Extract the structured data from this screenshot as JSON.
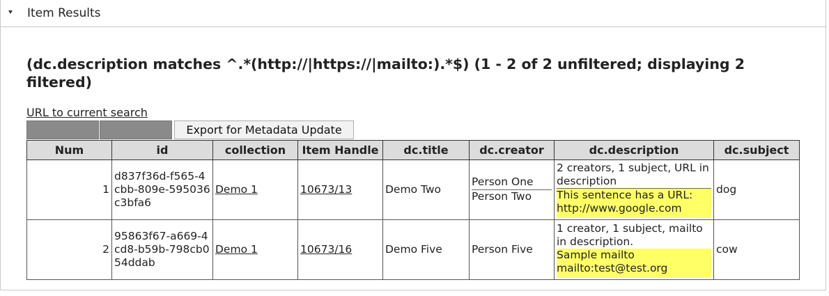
{
  "panel": {
    "title": "Item Results"
  },
  "query": {
    "title": "(dc.description matches ^.*(http://|https://|mailto:).*$) (1 - 2 of 2 unfiltered; displaying 2 filtered)",
    "url_link": "URL to current search"
  },
  "toolbar": {
    "export_label": "Export for Metadata Update"
  },
  "table": {
    "headers": [
      "Num",
      "id",
      "collection",
      "Item Handle",
      "dc.title",
      "dc.creator",
      "dc.description",
      "dc.subject"
    ],
    "rows": [
      {
        "num": "1",
        "id": "d837f36d-f565-4cbb-809e-595036c3bfa6",
        "collection": "Demo 1",
        "handle": "10673/13",
        "title": "Demo Two",
        "creators": [
          "Person One",
          "Person Two"
        ],
        "descriptions": [
          "2 creators, 1 subject, URL in description",
          "This sentence has a URL: http://www.google.com"
        ],
        "subject": "dog"
      },
      {
        "num": "2",
        "id": "95863f67-a669-4cd8-b59b-798cb054ddab",
        "collection": "Demo 1",
        "handle": "10673/16",
        "title": "Demo Five",
        "creators": [
          "Person Five"
        ],
        "descriptions": [
          "1 creator, 1 subject, mailto in description.",
          "Sample mailto mailto:test@test.org"
        ],
        "subject": "cow"
      }
    ]
  },
  "colors": {
    "highlight": "#ffff66",
    "header_bg": "#dcdcdc",
    "blank_button": "#8a8a8a"
  },
  "icons": {
    "panel_toggle": "caret-down-icon"
  }
}
